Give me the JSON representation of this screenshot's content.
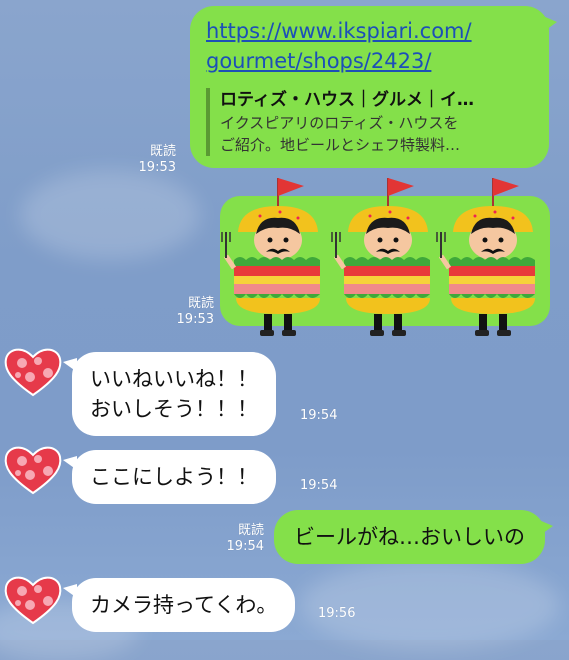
{
  "messages": {
    "link": {
      "url_line1": "https://www.ikspiari.com/",
      "url_line2": "gourmet/shops/2423/",
      "preview_title": "ロティズ・ハウス｜グルメ｜イ…",
      "preview_desc_line1": "イクスピアリのロティズ・ハウスを",
      "preview_desc_line2": "ご紹介。地ビールとシェフ特製料…",
      "read": "既読",
      "time": "19:53"
    },
    "sticker": {
      "read": "既読",
      "time": "19:53",
      "icon": "burger-mascot-sticker"
    },
    "in1": {
      "line1": "いいねいいね！！",
      "line2": "おいしそう！！！",
      "time": "19:54"
    },
    "in2": {
      "text": "ここにしよう！！",
      "time": "19:54"
    },
    "out2": {
      "text": "ビールがね…おいしいの",
      "read": "既読",
      "time": "19:54"
    },
    "in3": {
      "text": "カメラ持ってくわ。",
      "time": "19:56"
    }
  },
  "colors": {
    "background": "#7f9dc9",
    "outgoing_bubble": "#84e04a",
    "incoming_bubble": "#ffffff",
    "link": "#1c4fb8",
    "avatar_heart": "#e63a4a"
  },
  "icons": {
    "avatar": "heart-avatar-icon"
  }
}
